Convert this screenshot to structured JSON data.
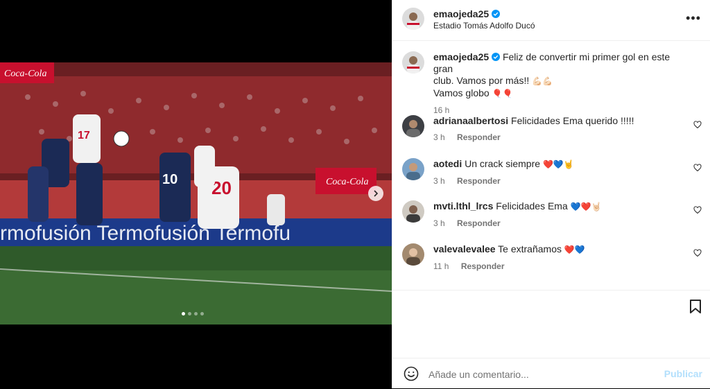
{
  "post": {
    "username": "emaojeda25",
    "location": "Estadio Tomás Adolfo Ducó",
    "more_icon": "•••",
    "caption": {
      "username": "emaojeda25",
      "line1": "Feliz de convertir mi primer gol en este gran",
      "line2": "club. Vamos por más!!",
      "line2_emoji": "💪🏻💪🏻",
      "line3": "Vamos globo",
      "line3_emoji": "🎈🎈",
      "time": "16 h"
    },
    "carousel": {
      "slides": 4,
      "active": 0
    }
  },
  "comments": [
    {
      "username": "adrianaalbertosi",
      "text": "Felicidades Ema querido !!!!!",
      "emoji": "",
      "time": "3 h",
      "reply": "Responder"
    },
    {
      "username": "aotedi",
      "text": "Un crack siempre",
      "emoji": "❤️💙🤘",
      "time": "3 h",
      "reply": "Responder"
    },
    {
      "username": "mvti.lthl_lrcs",
      "text": "Felicidades Ema",
      "emoji": "💙❤️🤘🏻",
      "time": "3 h",
      "reply": "Responder"
    },
    {
      "username": "valevalevalee",
      "text": "Te extrañamos",
      "emoji": "❤️💙",
      "time": "11 h",
      "reply": "Responder"
    }
  ],
  "composer": {
    "placeholder": "Añade un comentario...",
    "publish": "Publicar"
  },
  "colors": {
    "accent": "#0095f6",
    "publish_disabled": "#b2dffc",
    "verified": "#0095f6"
  }
}
